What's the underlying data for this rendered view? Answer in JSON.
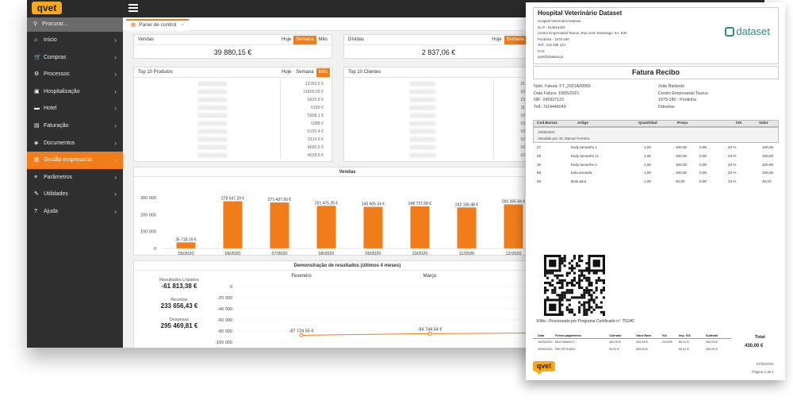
{
  "app": {
    "logo": "qvet",
    "search_placeholder": "Procurar...",
    "tab_label": "Panel de control"
  },
  "sidebar": {
    "items": [
      {
        "label": "Início",
        "icon": "home-icon",
        "glyph": "⌂"
      },
      {
        "label": "Compras",
        "icon": "cart-icon",
        "glyph": "🛒"
      },
      {
        "label": "Processos",
        "icon": "gear-icon",
        "glyph": "⚙"
      },
      {
        "label": "Hospitalização",
        "icon": "hospital-icon",
        "glyph": "▣"
      },
      {
        "label": "Hotel",
        "icon": "bed-icon",
        "glyph": "▬"
      },
      {
        "label": "Faturação",
        "icon": "invoice-icon",
        "glyph": "▤"
      },
      {
        "label": "Documentos",
        "icon": "layers-icon",
        "glyph": "◈"
      },
      {
        "label": "Gestão empresarial",
        "icon": "chart-icon",
        "glyph": "▥"
      },
      {
        "label": "Parâmetros",
        "icon": "sliders-icon",
        "glyph": "≡"
      },
      {
        "label": "Utilidades",
        "icon": "wrench-icon",
        "glyph": "✎"
      },
      {
        "label": "Ajuda",
        "icon": "help-icon",
        "glyph": "?"
      }
    ],
    "active_index": 7
  },
  "periods": {
    "day": "Hoje",
    "week": "Semana",
    "month": "Mês"
  },
  "vendas_card": {
    "title": "Vendas",
    "value": "39 880,15 €",
    "active": "Semana"
  },
  "dividas_card": {
    "title": "Dívidas",
    "value": "2 837,06 €",
    "active": "Semana"
  },
  "top_produtos": {
    "title": "Top 10 Produtos",
    "active": "Mês",
    "values": [
      "13163.5 €",
      "11803.03 €",
      "6932.8 €",
      "6180 €",
      "5908.1 €",
      "5288 €",
      "5192.4 €",
      "5114.5 €",
      "4665.5 €",
      "4028.6 €"
    ]
  },
  "top_clientes": {
    "title": "Top 10 Clientes",
    "values": [
      "21",
      "16",
      "15",
      "11",
      "10",
      "10",
      "10",
      "10",
      "10",
      "10"
    ]
  },
  "vendas_chart_title": "Vendas",
  "resultados": {
    "title": "Demonstração de resultados (últimos 4 meses)",
    "items": [
      {
        "label": "Resultados Líquidos",
        "value": "-61 813,38 €"
      },
      {
        "label": "Receitas",
        "value": "233 656,43 €"
      },
      {
        "label": "Despesas",
        "value": "295 469,81 €"
      }
    ]
  },
  "chart_data": [
    {
      "type": "bar",
      "title": "Vendas",
      "categories": [
        "05/2020",
        "06/2020",
        "07/2020",
        "08/2020",
        "09/2020",
        "10/2020",
        "11/2020",
        "12/2020"
      ],
      "values": [
        35718.19,
        278547.29,
        271437.56,
        251475.25,
        245605.34,
        248727.68,
        242156.48,
        260365.84
      ],
      "labels": [
        "35 718.19 €",
        "278 547.29 €",
        "271 437.56 €",
        "251 475.25 €",
        "245 605.34 €",
        "248 727.68 €",
        "242 156.48 €",
        "260 365.84 €"
      ],
      "yticks": [
        "300 000",
        "200 000",
        "100 000",
        "0"
      ],
      "ylim": [
        0,
        300000
      ],
      "color": "#f07d1a"
    },
    {
      "type": "line",
      "title": "Demonstração de resultados (últimos 4 meses)",
      "categories": [
        "Fevereiro",
        "Março"
      ],
      "values": [
        -87724.55,
        -84744.54
      ],
      "labels": [
        "-87 724.55 €",
        "-84 744.54 €"
      ],
      "yticks": [
        "0",
        "-20 000",
        "-40 000",
        "-60 000",
        "-80 000",
        "-100 000"
      ],
      "ylim": [
        -100000,
        0
      ],
      "color": "#f07d1a"
    }
  ],
  "invoice": {
    "hospital": "Hospital Veterinário Dataset",
    "lines": [
      "Hospital Veterinário Dataset",
      "N.I.F.: 514813423",
      "Centro Empresarial Taurus, Rua José Saramago, 5A, E36",
      "Pontinha - 1675-180",
      "Telf.: 210 485 124",
      "FAX:",
      "qvet@dataset.pt"
    ],
    "brand": "dataset",
    "title": "Fatura Recibo",
    "meta_left": [
      "Núm. Fatura: FT_2021A00059",
      "Data Fatura: 10/05/2021",
      "NIF: 245927123",
      "Telf.: /914446049"
    ],
    "meta_right": [
      "João Barbedo",
      "Centro Empresarial Taurus",
      "1675-180 - Pontinha",
      "Odivelas"
    ],
    "columns": [
      "Cod.Barras",
      "Artigo",
      "Quantidad",
      "Preço",
      "IVA",
      "Valor"
    ],
    "date_line": "10/05/2021",
    "attended": "Atendido por: Dr. Manuel Ferreira",
    "items": [
      {
        "cod": "27",
        "artigo": "body tamanho 1",
        "qty": "1,00",
        "preco": "100,00",
        "desc": "0,00",
        "iva": "23 %",
        "valor": "100,00"
      },
      {
        "cod": "29",
        "artigo": "body tamanho 11",
        "qty": "1,00",
        "preco": "100,00",
        "desc": "0,00",
        "iva": "23 %",
        "valor": "100,00"
      },
      {
        "cod": "28",
        "artigo": "body tamanho 2",
        "qty": "1,00",
        "preco": "100,00",
        "desc": "0,00",
        "iva": "23 %",
        "valor": "100,00"
      },
      {
        "cod": "58",
        "artigo": "bola amarela",
        "qty": "1,00",
        "preco": "100,00",
        "desc": "0,00",
        "iva": "23 %",
        "valor": "100,00"
      },
      {
        "cod": "46",
        "artigo": "Bola azul",
        "qty": "1,00",
        "preco": "30,00",
        "desc": "0,00",
        "iva": "23 %",
        "valor": "30,00"
      }
    ],
    "processed": "XiWa - Processado por Programa Certificado n.º 752/AT",
    "pay_columns": [
      "Data",
      "Forma pagamento",
      "Cobrado",
      "Valor Base",
      "IVA",
      "Imp. IVA",
      "Subtotal"
    ],
    "payments": [
      {
        "data": "10/05/2021",
        "forma": "MULTIBANCO",
        "cobrado": "400,00 €",
        "base": "349,59 €",
        "iva": "23,00%",
        "imp": "80,41 €",
        "sub": "400,00 €"
      },
      {
        "data": "10/05/2021",
        "forma": "RECTIFICADO",
        "cobrado": "30,00 €",
        "base": "349,59 €",
        "iva": "",
        "imp": "80,41 €",
        "sub": "430,00 €"
      }
    ],
    "total_label": "Total",
    "total_value": "430,00 €",
    "footer_logo": "qvet",
    "footer_date": "27/05/2021",
    "footer_page": "Página 1 de 1"
  }
}
